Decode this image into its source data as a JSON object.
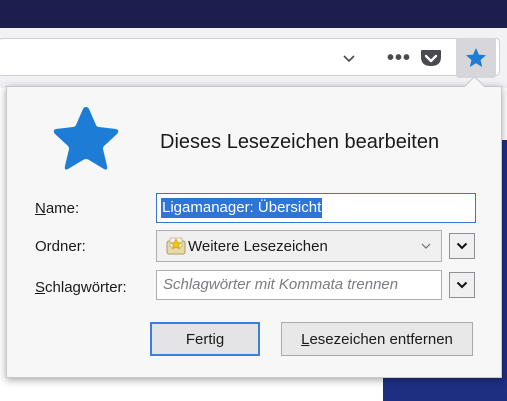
{
  "toolbar": {
    "chevron_icon": "chevron-down-icon",
    "more_icon": "ellipsis-icon",
    "more_label": "•••",
    "pocket_icon": "pocket-icon",
    "bookmark_star_icon": "star-icon",
    "accent": "#1a73e8"
  },
  "panel": {
    "title": "Dieses Lesezeichen bearbeiten",
    "name_label": "Name:",
    "name_label_accesskey": "N",
    "name_label_rest": "ame:",
    "name_value": "Ligamanager: Übersicht",
    "folder_label": "Ordner:",
    "folder_value": "Weitere Lesezeichen",
    "tags_label": "Schlagwörter:",
    "tags_label_accesskey": "S",
    "tags_label_rest": "chlagwörter:",
    "tags_placeholder": "Schlagwörter mit Kommata trennen",
    "done_button": "Fertig",
    "remove_button": "Lesezeichen entfernen",
    "remove_button_accesskey": "L",
    "remove_button_rest": "esezeichen entfernen"
  },
  "colors": {
    "star_blue": "#1c7cd6",
    "selection_blue": "#2f75d6",
    "page_dark": "#1c1f4e"
  }
}
